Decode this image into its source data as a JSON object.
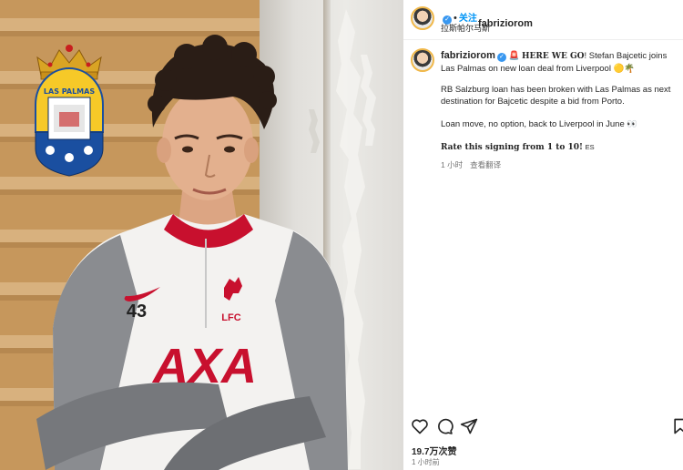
{
  "header": {
    "username": "fabriziorom",
    "verified_icon": "verified-icon",
    "separator": "•",
    "follow_label": "关注",
    "location": "拉斯帕尔马斯"
  },
  "post": {
    "username": "fabriziorom",
    "siren": "🚨",
    "here_we_go": "HERE WE GO",
    "headline": "! Stefan Bajcetic joins Las Palmas on new loan deal from Liverpool",
    "headline_emojis": "🟡🌴",
    "paragraph2": "RB Salzburg loan has been broken with Las Palmas as next destination for Bajcetic despite a bid from Porto.",
    "paragraph3": "Loan move, no option, back to Liverpool in June",
    "paragraph3_emoji": "👀",
    "rate": "Rate this signing from 1 to 10!",
    "rate_suffix": "ES",
    "time": "1 小时",
    "translate": "查看翻译"
  },
  "footer": {
    "likes": "19.7万次赞",
    "time": "1 小时前"
  },
  "photo": {
    "shirt_number": "43",
    "sponsor": "AXA",
    "crest_text": "LFC",
    "badge_text": "LAS PALMAS"
  },
  "icons": {
    "like": "heart-icon",
    "comment": "comment-icon",
    "share": "share-icon",
    "save": "bookmark-icon"
  }
}
